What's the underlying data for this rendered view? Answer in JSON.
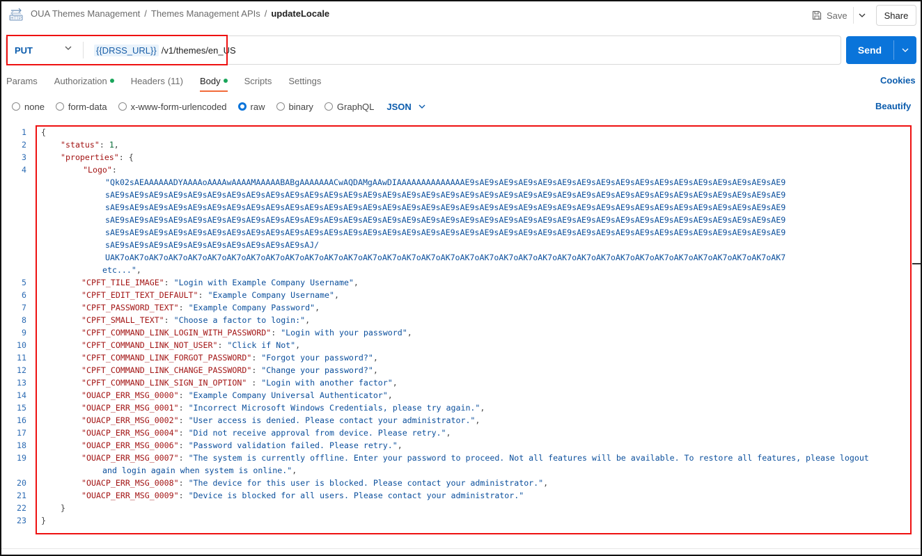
{
  "header": {
    "breadcrumb": [
      "OUA Themes Management",
      "Themes Management APIs"
    ],
    "current": "updateLocale",
    "save_label": "Save",
    "share_label": "Share"
  },
  "request": {
    "method": "PUT",
    "url_variable": "{{DRSS_URL}}",
    "url_path": "/v1/themes/en_US",
    "send_label": "Send"
  },
  "tabs": {
    "params": "Params",
    "authorization": "Authorization",
    "headers": "Headers",
    "headers_count": "(11)",
    "body": "Body",
    "scripts": "Scripts",
    "settings": "Settings",
    "cookies": "Cookies"
  },
  "body_types": {
    "none": "none",
    "form_data": "form-data",
    "urlencoded": "x-www-form-urlencoded",
    "raw": "raw",
    "binary": "binary",
    "graphql": "GraphQL",
    "format": "JSON",
    "beautify": "Beautify"
  },
  "editor": {
    "lines": [
      {
        "n": "1",
        "text": "{"
      },
      {
        "n": "2",
        "key": "\"status\"",
        "sep": ": ",
        "num": "1",
        "tail": ","
      },
      {
        "n": "3",
        "key": "\"properties\"",
        "sep": ": {"
      },
      {
        "n": "4",
        "key": "\"Logo\"",
        "sep": ":"
      },
      {
        "n": "",
        "str": "\"Qk02sAEAAAAAADYAAAAoAAAAwAAAAMAAAAABABgAAAAAAACwAQDAMgAAwDIAAAAAAAAAAAAAAE9sAE9sAE9sAE9sAE9sAE9sAE9sAE9sAE9sAE9sAE9sAE9sAE9sAE9sAE9sAE9sAE9"
      },
      {
        "n": "",
        "str": "sAE9sAE9sAE9sAE9sAE9sAE9sAE9sAE9sAE9sAE9sAE9sAE9sAE9sAE9sAE9sAE9sAE9sAE9sAE9sAE9sAE9sAE9sAE9sAE9sAE9sAE9sAE9sAE9sAE9sAE9sAE9sAE9sAE9sAE9sAE9"
      },
      {
        "n": "",
        "str": "sAE9sAE9sAE9sAE9sAE9sAE9sAE9sAE9sAE9sAE9sAE9sAE9sAE9sAE9sAE9sAE9sAE9sAE9sAE9sAE9sAE9sAE9sAE9sAE9sAE9sAE9sAE9sAE9sAE9sAE9sAE9sAE9sAE9sAE9sAE9"
      },
      {
        "n": "",
        "str": "sAE9sAE9sAE9sAE9sAE9sAE9sAE9sAE9sAE9sAE9sAE9sAE9sAE9sAE9sAE9sAE9sAE9sAE9sAE9sAE9sAE9sAE9sAE9sAE9sAE9sAE9sAE9sAE9sAE9sAE9sAE9sAE9sAE9sAE9sAE9"
      },
      {
        "n": "",
        "str": "sAE9sAE9sAE9sAE9sAE9sAE9sAE9sAE9sAE9sAE9sAE9sAE9sAE9sAE9sAE9sAE9sAE9sAE9sAE9sAE9sAE9sAE9sAE9sAE9sAE9sAE9sAE9sAE9sAE9sAE9sAE9sAE9sAE9sAE9sAE9"
      },
      {
        "n": "",
        "str": "sAE9sAE9sAE9sAE9sAE9sAE9sAE9sAE9sAE9sAE9sAJ/"
      },
      {
        "n": "",
        "str": "UAK7oAK7oAK7oAK7oAK7oAK7oAK7oAK7oAK7oAK7oAK7oAK7oAK7oAK7oAK7oAK7oAK7oAK7oAK7oAK7oAK7oAK7oAK7oAK7oAK7oAK7oAK7oAK7oAK7oAK7oAK7oAK7oAK7oAK7oAK7"
      },
      {
        "n": "",
        "str": "etc...\"",
        "tail": ","
      },
      {
        "n": "5",
        "key": "\"CPFT_TILE_IMAGE\"",
        "sep": ": ",
        "str": "\"Login with Example Company Username\"",
        "tail": ","
      },
      {
        "n": "6",
        "key": "\"CPFT_EDIT_TEXT_DEFAULT\"",
        "sep": ": ",
        "str": "\"Example Company Username\"",
        "tail": ","
      },
      {
        "n": "7",
        "key": "\"CPFT_PASSWORD_TEXT\"",
        "sep": ": ",
        "str": "\"Example Company Password\"",
        "tail": ","
      },
      {
        "n": "8",
        "key": "\"CPFT_SMALL_TEXT\"",
        "sep": ": ",
        "str": "\"Choose a factor to login:\"",
        "tail": ","
      },
      {
        "n": "9",
        "key": "\"CPFT_COMMAND_LINK_LOGIN_WITH_PASSWORD\"",
        "sep": ": ",
        "str": "\"Login with your password\"",
        "tail": ","
      },
      {
        "n": "10",
        "key": "\"CPFT_COMMAND_LINK_NOT_USER\"",
        "sep": ": ",
        "str": "\"Click if Not\"",
        "tail": ","
      },
      {
        "n": "11",
        "key": "\"CPFT_COMMAND_LINK_FORGOT_PASSWORD\"",
        "sep": ": ",
        "str": "\"Forgot your password?\"",
        "tail": ","
      },
      {
        "n": "12",
        "key": "\"CPFT_COMMAND_LINK_CHANGE_PASSWORD\"",
        "sep": ": ",
        "str": "\"Change your password?\"",
        "tail": ","
      },
      {
        "n": "13",
        "key": "\"CPFT_COMMAND_LINK_SIGN_IN_OPTION\"",
        "sep": " : ",
        "str": "\"Login with another factor\"",
        "tail": ","
      },
      {
        "n": "14",
        "key": "\"OUACP_ERR_MSG_0000\"",
        "sep": ": ",
        "str": "\"Example Company Universal Authenticator\"",
        "tail": ","
      },
      {
        "n": "15",
        "key": "\"OUACP_ERR_MSG_0001\"",
        "sep": ": ",
        "str": "\"Incorrect Microsoft Windows Credentials, please try again.\"",
        "tail": ","
      },
      {
        "n": "16",
        "key": "\"OUACP_ERR_MSG_0002\"",
        "sep": ": ",
        "str": "\"User access is denied. Please contact your administrator.\"",
        "tail": ","
      },
      {
        "n": "17",
        "key": "\"OUACP_ERR_MSG_0004\"",
        "sep": ": ",
        "str": "\"Did not receive approval from device. Please retry.\"",
        "tail": ","
      },
      {
        "n": "18",
        "key": "\"OUACP_ERR_MSG_0006\"",
        "sep": ": ",
        "str": "\"Password validation failed. Please retry.\"",
        "tail": ","
      },
      {
        "n": "19",
        "key": "\"OUACP_ERR_MSG_0007\"",
        "sep": ": ",
        "str": "\"The system is currently offline. Enter your password to proceed. Not all features will be available. To restore all features, please logout"
      },
      {
        "n": "",
        "str": "and login again when system is online.\"",
        "tail": ","
      },
      {
        "n": "20",
        "key": "\"OUACP_ERR_MSG_0008\"",
        "sep": ": ",
        "str": "\"The device for this user is blocked. Please contact your administrator.\"",
        "tail": ","
      },
      {
        "n": "21",
        "key": "\"OUACP_ERR_MSG_0009\"",
        "sep": ": ",
        "str": "\"Device is blocked for all users. Please contact your administrator.\""
      },
      {
        "n": "22",
        "text": "}"
      },
      {
        "n": "23",
        "text": "}"
      }
    ]
  }
}
